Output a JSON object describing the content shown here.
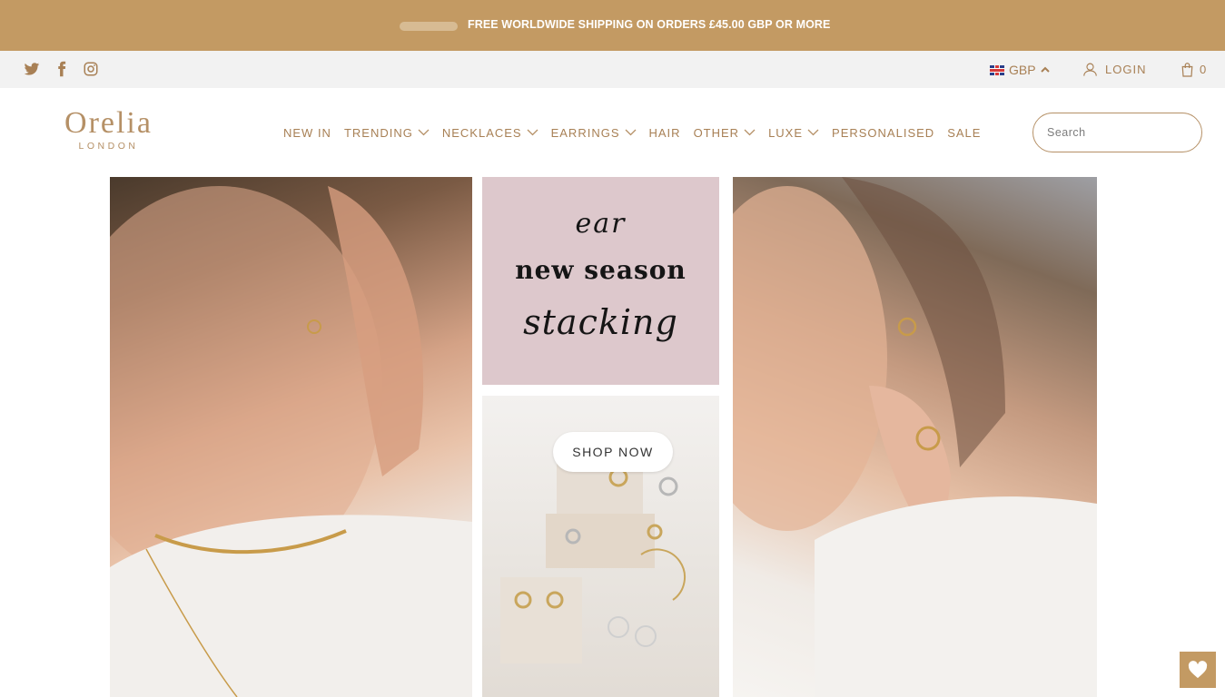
{
  "announcement": {
    "text": "FREE WORLDWIDE SHIPPING ON ORDERS £45.00 GBP OR MORE"
  },
  "topbar": {
    "social_icons": [
      "twitter-icon",
      "facebook-icon",
      "instagram-icon"
    ],
    "currency": "GBP",
    "login_label": "LOGIN",
    "cart_count": "0"
  },
  "header": {
    "logo_name": "Orelia",
    "logo_sub": "LONDON",
    "nav": [
      {
        "label": "NEW IN",
        "dropdown": false
      },
      {
        "label": "TRENDING",
        "dropdown": true
      },
      {
        "label": "NECKLACES",
        "dropdown": true
      },
      {
        "label": "EARRINGS",
        "dropdown": true
      },
      {
        "label": "HAIR",
        "dropdown": false
      },
      {
        "label": "OTHER",
        "dropdown": true
      },
      {
        "label": "LUXE",
        "dropdown": true
      },
      {
        "label": "PERSONALISED",
        "dropdown": false
      },
      {
        "label": "SALE",
        "dropdown": false
      }
    ],
    "search_placeholder": "Search"
  },
  "hero": {
    "promo_line1": "ear",
    "promo_line2": "new season",
    "promo_line3": "stacking",
    "cta_label": "SHOP NOW"
  },
  "colors": {
    "accent": "#c39a63",
    "text_gold": "#a88055"
  }
}
